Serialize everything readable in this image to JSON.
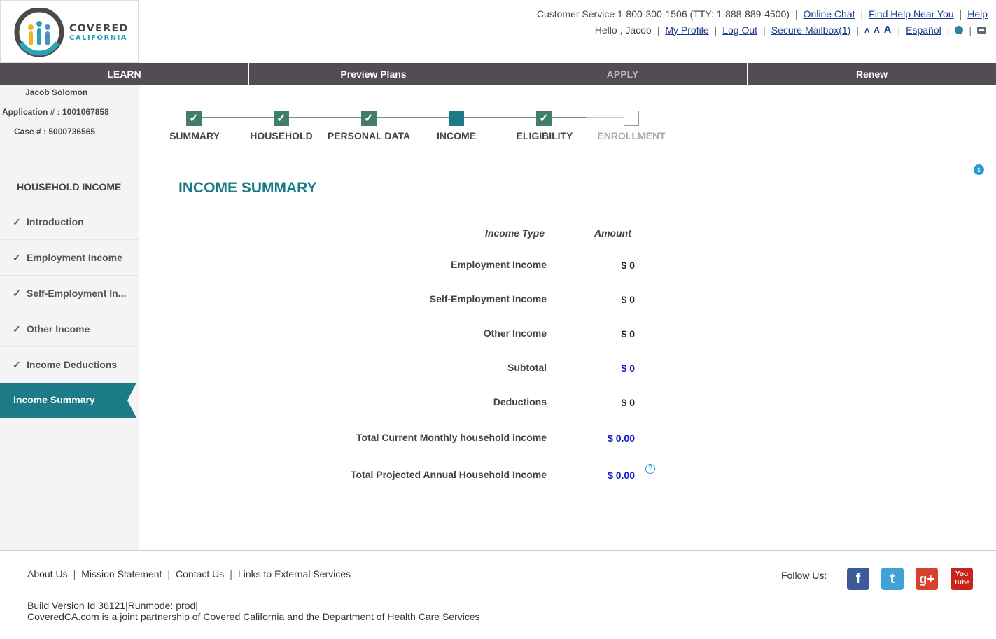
{
  "header": {
    "logo_word1": "COVERED",
    "logo_word2": "CALIFORNIA",
    "customer_service": "Customer Service 1-800-300-1506 (TTY: 1-888-889-4500)",
    "online_chat": "Online Chat",
    "find_help": "Find Help Near You",
    "help": "Help",
    "greeting": "Hello , Jacob",
    "my_profile": "My Profile",
    "log_out": "Log Out",
    "secure_mailbox": "Secure Mailbox(1)",
    "font_small": "A",
    "font_medium": "A",
    "font_large": "A",
    "espanol": "Español"
  },
  "nav": {
    "learn": "LEARN",
    "preview_plans": "Preview Plans",
    "apply": "APPLY",
    "renew": "Renew"
  },
  "applicant": {
    "name": "Jacob Solomon",
    "application": "Application # : 1001067858",
    "case": "Case # : 5000736565"
  },
  "sidebar": {
    "heading": "HOUSEHOLD INCOME",
    "items": [
      {
        "label": "Introduction",
        "done": true
      },
      {
        "label": "Employment Income",
        "done": true
      },
      {
        "label": "Self-Employment In...",
        "done": true
      },
      {
        "label": "Other Income",
        "done": true
      },
      {
        "label": "Income Deductions",
        "done": true
      }
    ],
    "active": "Income Summary"
  },
  "progress": {
    "steps": [
      {
        "label": "SUMMARY",
        "state": "done"
      },
      {
        "label": "HOUSEHOLD",
        "state": "done"
      },
      {
        "label": "PERSONAL DATA",
        "state": "done"
      },
      {
        "label": "INCOME",
        "state": "current"
      },
      {
        "label": "ELIGIBILITY",
        "state": "done"
      },
      {
        "label": "ENROLLMENT",
        "state": "pending"
      }
    ]
  },
  "main": {
    "title": "INCOME SUMMARY",
    "col_type": "Income Type",
    "col_amount": "Amount",
    "rows": [
      {
        "label": "Employment Income",
        "value": "$ 0"
      },
      {
        "label": "Self-Employment Income",
        "value": "$ 0"
      },
      {
        "label": "Other Income",
        "value": "$ 0"
      },
      {
        "label": "Subtotal",
        "value": "$ 0"
      },
      {
        "label": "Deductions",
        "value": "$ 0"
      },
      {
        "label": "Total Current Monthly household income",
        "value": "$ 0.00"
      },
      {
        "label": "Total Projected Annual Household Income",
        "value": "$ 0.00"
      }
    ]
  },
  "footer": {
    "about": "About Us",
    "mission": "Mission Statement",
    "contact": "Contact Us",
    "links_external": "Links to External Services",
    "build": "Build Version Id 36121",
    "runmode": "Runmode: prod",
    "partnership": "CoveredCA.com is a joint partnership of Covered California and the Department of Health Care Services",
    "follow_us": "Follow Us:"
  },
  "colors": {
    "teal": "#1b7b86",
    "nav_bg": "#524c55",
    "check_green": "#3f7f69",
    "amount_blue": "#1a1ac8"
  }
}
